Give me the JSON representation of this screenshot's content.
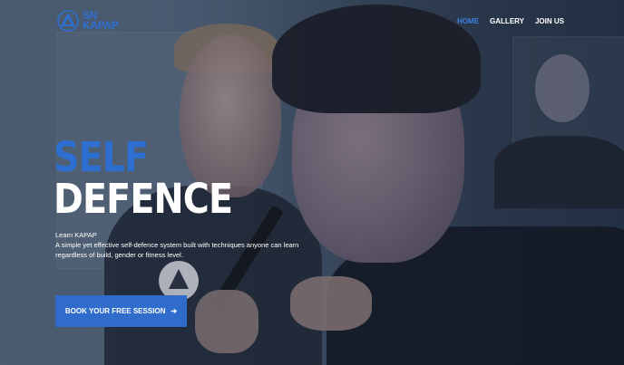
{
  "brand": {
    "line1": "SN",
    "line2": "KAPAP",
    "color": "#2f6fd1"
  },
  "nav": {
    "items": [
      {
        "label": "HOME",
        "active": true
      },
      {
        "label": "GALLERY",
        "active": false
      },
      {
        "label": "JOIN US",
        "active": false
      }
    ]
  },
  "hero": {
    "title_line1": "SELF",
    "title_line2": "DEFENCE",
    "lead": "Learn KAPAP",
    "description": "A simple yet effective self-defence system built with techniques anyone can learn regardless of build, gender or fitness level.",
    "cta_label": "BOOK YOUR FREE SESSION",
    "cta_icon": "arrow-right-icon"
  },
  "colors": {
    "accent": "#2f6ccb",
    "title_blue": "#2d6fd0",
    "white": "#ffffff"
  }
}
